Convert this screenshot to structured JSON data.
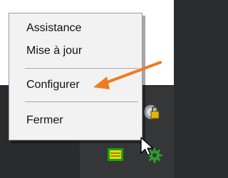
{
  "context_menu": {
    "items": [
      {
        "label": "Assistance"
      },
      {
        "label": "Mise à jour"
      },
      {
        "label": "Configurer"
      },
      {
        "label": "Fermer"
      }
    ]
  },
  "annotation": {
    "color": "#f07a20"
  },
  "tray": {
    "icons": [
      "security-lock-icon",
      "green-yellow-app-icon",
      "gear-icon"
    ]
  },
  "cursor": "mouse-pointer-icon"
}
